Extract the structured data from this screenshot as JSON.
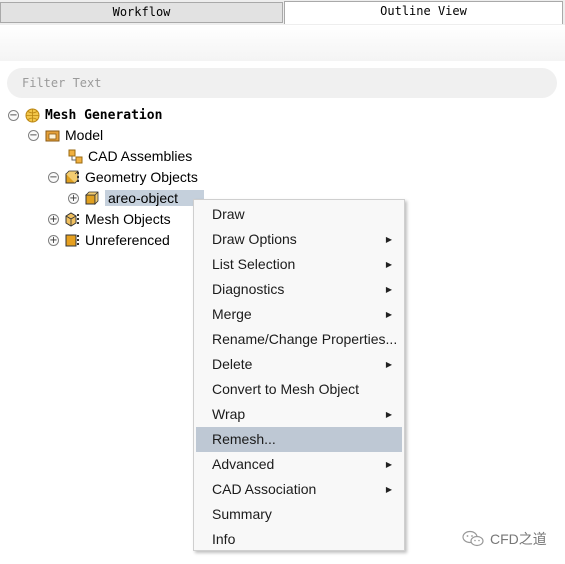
{
  "tabs": {
    "workflow": "Workflow",
    "outline_view": "Outline View"
  },
  "filter": {
    "placeholder": "Filter Text",
    "value": ""
  },
  "tree": {
    "root": "Mesh Generation",
    "model": "Model",
    "cad_assemblies": "CAD Assemblies",
    "geometry_objects": "Geometry Objects",
    "areo_object": "areo-object",
    "mesh_objects": "Mesh Objects",
    "unreferenced": "Unreferenced",
    "collapse_symbol": "−",
    "expand_symbol": "+"
  },
  "context_menu": {
    "items": [
      {
        "label": "Draw",
        "submenu": false
      },
      {
        "label": "Draw Options",
        "submenu": true
      },
      {
        "label": "List Selection",
        "submenu": true
      },
      {
        "label": "Diagnostics",
        "submenu": true
      },
      {
        "label": "Merge",
        "submenu": true
      },
      {
        "label": "Rename/Change Properties...",
        "submenu": false
      },
      {
        "label": "Delete",
        "submenu": true
      },
      {
        "label": "Convert to Mesh Object",
        "submenu": false
      },
      {
        "label": "Wrap",
        "submenu": true
      },
      {
        "label": "Remesh...",
        "submenu": false,
        "highlighted": true
      },
      {
        "label": "Advanced",
        "submenu": true
      },
      {
        "label": "CAD Association",
        "submenu": true
      },
      {
        "label": "Summary",
        "submenu": false
      },
      {
        "label": "Info",
        "submenu": false
      }
    ],
    "submenu_arrow": "▶"
  },
  "watermark": {
    "text": "CFD之道"
  },
  "colors": {
    "selection": "#c5d0dc",
    "menu_highlight": "#bec8d4",
    "geometry_icon": "#e0a020"
  }
}
